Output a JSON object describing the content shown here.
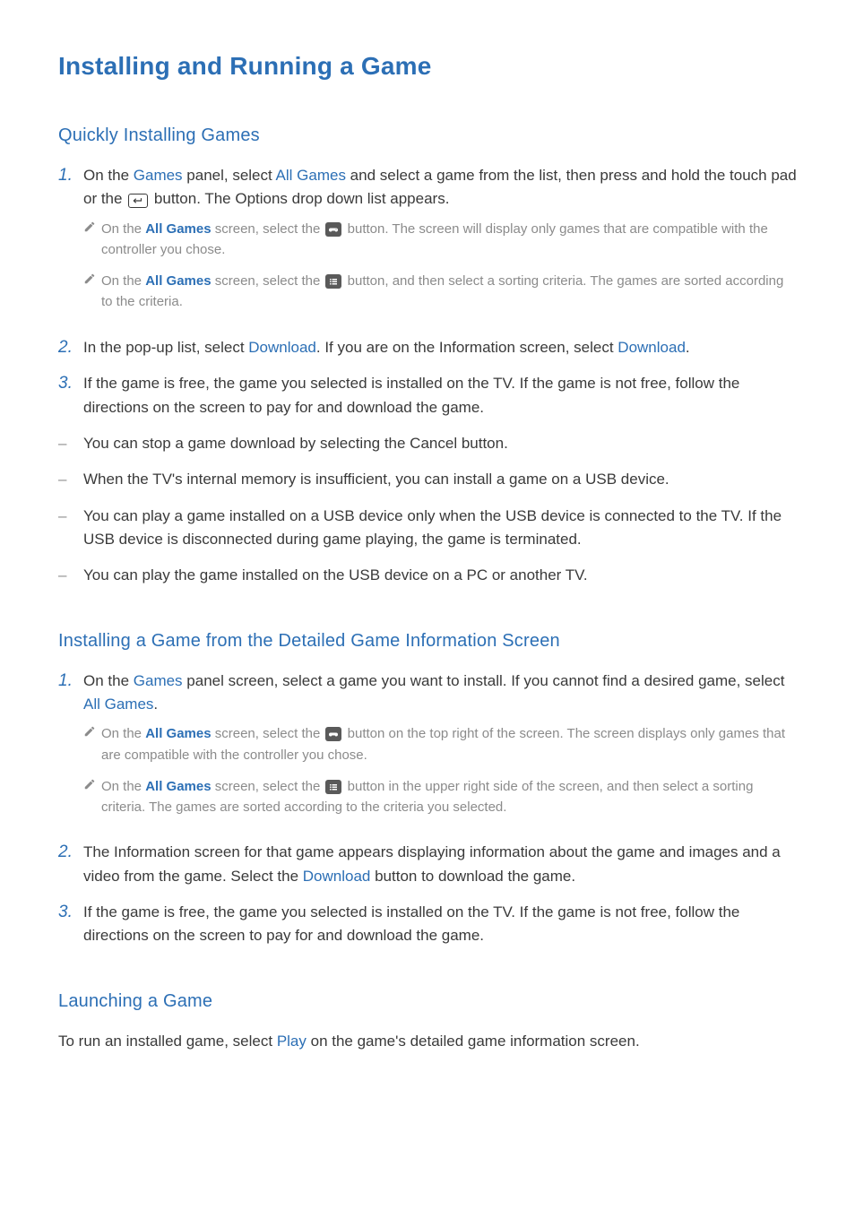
{
  "title": "Installing and Running a Game",
  "sections": {
    "quick": {
      "heading": "Quickly Installing Games",
      "items": {
        "1": {
          "pre": "On the ",
          "hl1": "Games",
          "mid1": " panel, select ",
          "hl2": "All Games",
          "mid2": " and select a game from the list, then press and hold the touch pad or the ",
          "post": " button. The Options drop down list appears."
        },
        "1n1": {
          "pre": "On the ",
          "hl": "All Games",
          "mid": " screen, select the ",
          "post": " button. The screen will display only games that are compatible with the controller you chose."
        },
        "1n2": {
          "pre": "On the ",
          "hl": "All Games",
          "mid": " screen, select the ",
          "post": " button, and then select a sorting criteria. The games are sorted according to the criteria."
        },
        "2": {
          "pre": "In the pop-up list, select ",
          "hl1": "Download",
          "mid": ". If you are on the Information screen, select ",
          "hl2": "Download",
          "post": "."
        },
        "3": "If the game is free, the game you selected is installed on the TV. If the game is not free, follow the directions on the screen to pay for and download the game."
      },
      "dashes": [
        "You can stop a game download by selecting the Cancel button.",
        "When the TV's internal memory is insufficient, you can install a game on a USB device.",
        "You can play a game installed on a USB device only when the USB device is connected to the TV. If the USB device is disconnected during game playing, the game is terminated.",
        "You can play the game installed on the USB device on a PC or another TV."
      ]
    },
    "detail": {
      "heading": "Installing a Game from the Detailed Game Information Screen",
      "items": {
        "1": {
          "pre": "On the ",
          "hl1": "Games",
          "mid": " panel screen, select a game you want to install. If you cannot find a desired game, select ",
          "hl2": "All Games",
          "post": "."
        },
        "1n1": {
          "pre": "On the ",
          "hl": "All Games",
          "mid": " screen, select the ",
          "post": " button on the top right of the screen. The screen displays only games that are compatible with the controller you chose."
        },
        "1n2": {
          "pre": "On the ",
          "hl": "All Games",
          "mid": " screen, select the ",
          "post": " button in the upper right side of the screen, and then select a sorting criteria. The games are sorted according to the criteria you selected."
        },
        "2": {
          "pre": "The Information screen for that game appears displaying information about the game and images and a video from the game. Select the ",
          "hl": "Download",
          "post": " button to download the game."
        },
        "3": "If the game is free, the game you selected is installed on the TV. If the game is not free, follow the directions on the screen to pay for and download the game."
      }
    },
    "launch": {
      "heading": "Launching a Game",
      "body": {
        "pre": "To run an installed game, select ",
        "hl": "Play",
        "post": " on the game's detailed game information screen."
      }
    }
  }
}
